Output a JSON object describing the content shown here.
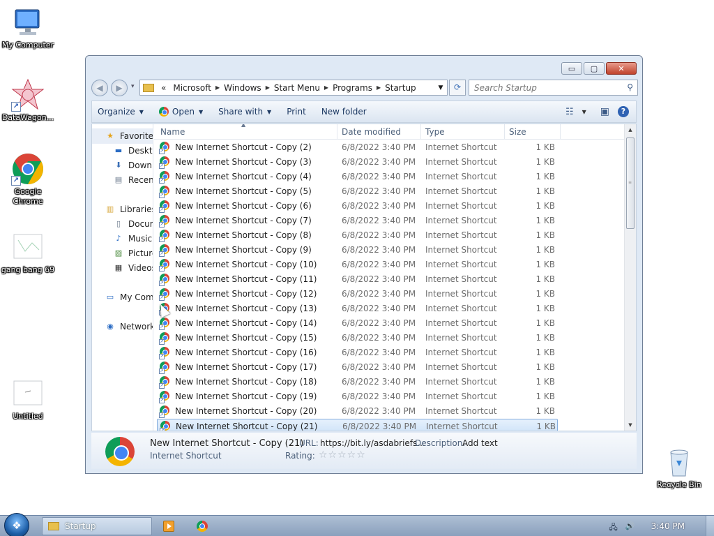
{
  "desktop": {
    "icons": [
      {
        "label": "My Computer",
        "icon": "computer-icon"
      },
      {
        "label": "DataWagon...",
        "icon": "datawagon-icon"
      },
      {
        "label": "Google Chrome",
        "icon": "chrome-icon"
      },
      {
        "label": "gang bang 69",
        "icon": "image-file-icon"
      },
      {
        "label": "Untitled",
        "icon": "image-file-icon"
      },
      {
        "label": "Recycle Bin",
        "icon": "recycle-bin-icon"
      }
    ]
  },
  "window": {
    "controls": {
      "minimize": "▭",
      "maximize": "▢",
      "close": "✕"
    },
    "nav": {
      "back": "◀",
      "forward": "▶",
      "history": "▾"
    },
    "address": {
      "prefix": "«",
      "crumbs": [
        "Microsoft",
        "Windows",
        "Start Menu",
        "Programs",
        "Startup"
      ],
      "separator": "▶",
      "dropdown": "▼",
      "refresh": "⟳"
    },
    "search": {
      "placeholder": "Search Startup",
      "icon": "⚲"
    },
    "toolbar": {
      "organize": "Organize",
      "open": "Open",
      "share_with": "Share with",
      "print": "Print",
      "new_folder": "New folder",
      "dropdown_arrow": "▼",
      "view_icon": "☷",
      "pane_icon": "▣",
      "help": "?"
    },
    "navpane": {
      "favorites": "Favorites",
      "desktop": "Desktop",
      "downloads": "Downloads",
      "recent": "Recent Places",
      "libraries": "Libraries",
      "documents": "Documents",
      "music": "Music",
      "pictures": "Pictures",
      "videos": "Videos",
      "computer": "My Computer",
      "network": "Network"
    },
    "columns": {
      "name": "Name",
      "date": "Date modified",
      "type": "Type",
      "size": "Size",
      "sort_arrow": "▲"
    },
    "files": [
      {
        "name": "New Internet Shortcut - Copy (2)",
        "date": "6/8/2022 3:40 PM",
        "type": "Internet Shortcut",
        "size": "1 KB"
      },
      {
        "name": "New Internet Shortcut - Copy (3)",
        "date": "6/8/2022 3:40 PM",
        "type": "Internet Shortcut",
        "size": "1 KB"
      },
      {
        "name": "New Internet Shortcut - Copy (4)",
        "date": "6/8/2022 3:40 PM",
        "type": "Internet Shortcut",
        "size": "1 KB"
      },
      {
        "name": "New Internet Shortcut - Copy (5)",
        "date": "6/8/2022 3:40 PM",
        "type": "Internet Shortcut",
        "size": "1 KB"
      },
      {
        "name": "New Internet Shortcut - Copy (6)",
        "date": "6/8/2022 3:40 PM",
        "type": "Internet Shortcut",
        "size": "1 KB"
      },
      {
        "name": "New Internet Shortcut - Copy (7)",
        "date": "6/8/2022 3:40 PM",
        "type": "Internet Shortcut",
        "size": "1 KB"
      },
      {
        "name": "New Internet Shortcut - Copy (8)",
        "date": "6/8/2022 3:40 PM",
        "type": "Internet Shortcut",
        "size": "1 KB"
      },
      {
        "name": "New Internet Shortcut - Copy (9)",
        "date": "6/8/2022 3:40 PM",
        "type": "Internet Shortcut",
        "size": "1 KB"
      },
      {
        "name": "New Internet Shortcut - Copy (10)",
        "date": "6/8/2022 3:40 PM",
        "type": "Internet Shortcut",
        "size": "1 KB"
      },
      {
        "name": "New Internet Shortcut - Copy (11)",
        "date": "6/8/2022 3:40 PM",
        "type": "Internet Shortcut",
        "size": "1 KB"
      },
      {
        "name": "New Internet Shortcut - Copy (12)",
        "date": "6/8/2022 3:40 PM",
        "type": "Internet Shortcut",
        "size": "1 KB"
      },
      {
        "name": "New Internet Shortcut - Copy (13)",
        "date": "6/8/2022 3:40 PM",
        "type": "Internet Shortcut",
        "size": "1 KB"
      },
      {
        "name": "New Internet Shortcut - Copy (14)",
        "date": "6/8/2022 3:40 PM",
        "type": "Internet Shortcut",
        "size": "1 KB"
      },
      {
        "name": "New Internet Shortcut - Copy (15)",
        "date": "6/8/2022 3:40 PM",
        "type": "Internet Shortcut",
        "size": "1 KB"
      },
      {
        "name": "New Internet Shortcut - Copy (16)",
        "date": "6/8/2022 3:40 PM",
        "type": "Internet Shortcut",
        "size": "1 KB"
      },
      {
        "name": "New Internet Shortcut - Copy (17)",
        "date": "6/8/2022 3:40 PM",
        "type": "Internet Shortcut",
        "size": "1 KB"
      },
      {
        "name": "New Internet Shortcut - Copy (18)",
        "date": "6/8/2022 3:40 PM",
        "type": "Internet Shortcut",
        "size": "1 KB"
      },
      {
        "name": "New Internet Shortcut - Copy (19)",
        "date": "6/8/2022 3:40 PM",
        "type": "Internet Shortcut",
        "size": "1 KB"
      },
      {
        "name": "New Internet Shortcut - Copy (20)",
        "date": "6/8/2022 3:40 PM",
        "type": "Internet Shortcut",
        "size": "1 KB"
      },
      {
        "name": "New Internet Shortcut - Copy (21)",
        "date": "6/8/2022 3:40 PM",
        "type": "Internet Shortcut",
        "size": "1 KB",
        "selected": true
      }
    ],
    "details": {
      "name": "New Internet Shortcut - Copy (21)",
      "type": "Internet Shortcut",
      "url_label": "URL:",
      "url_value": "https://bit.ly/asdabriefs...",
      "description_label": "Description:",
      "description_value": "Add text",
      "rating_label": "Rating:",
      "rating_stars": "☆☆☆☆☆"
    }
  },
  "taskbar": {
    "start_glyph": "❖",
    "active_task": "Startup",
    "tray_network": "🖧",
    "tray_volume": "🔊",
    "clock": "3:40 PM"
  },
  "colors": {
    "selection": "#cfe3f8",
    "selection_border": "#84acdd",
    "taskbar": "#8aa0bd"
  }
}
